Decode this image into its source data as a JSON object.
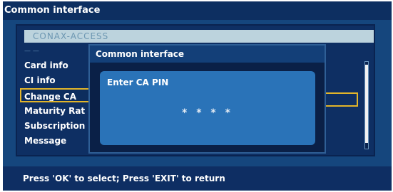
{
  "window": {
    "title": "Common interface"
  },
  "menu": {
    "header": "CONAX-ACCESS",
    "items": [
      {
        "label": "— —"
      },
      {
        "label": "Card info"
      },
      {
        "label": "CI info"
      },
      {
        "label": "Change CA"
      },
      {
        "label": "Maturity Rat"
      },
      {
        "label": "Subscription"
      },
      {
        "label": "Message"
      }
    ],
    "selected_index": 3
  },
  "dialog": {
    "title": "Common interface",
    "prompt": "Enter CA PIN",
    "pin_mask": "* * * *"
  },
  "status": {
    "hint": "Press 'OK' to select; Press 'EXIT' to return"
  },
  "colors": {
    "background": "#15467d",
    "bar_dark": "#0d2f61",
    "dialog_body": "#2a73b8",
    "selection_border": "#e2b52a",
    "header_strip": "#bcd3dd"
  }
}
